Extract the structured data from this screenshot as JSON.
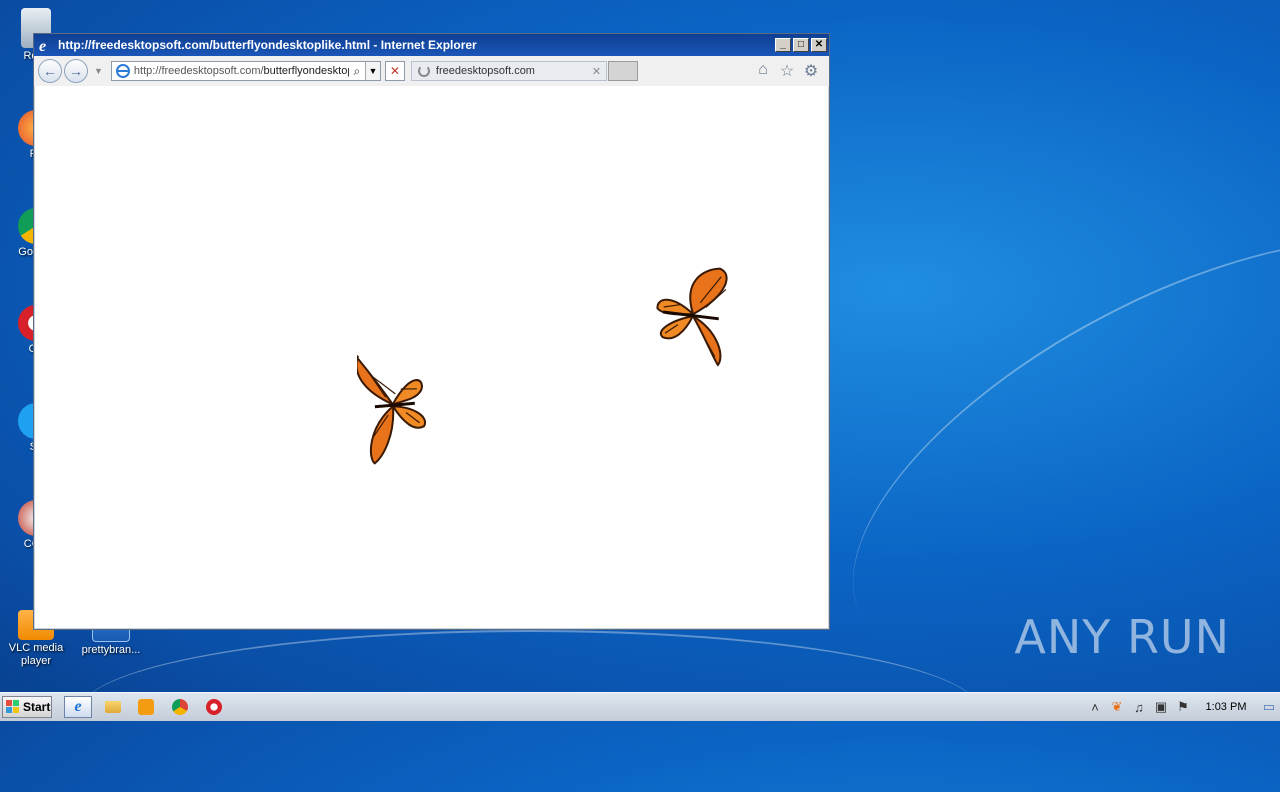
{
  "desktop": {
    "icons": [
      {
        "label": "Recy",
        "icon": "recycle-bin-icon"
      },
      {
        "label": "Fir",
        "icon": "firefox-icon"
      },
      {
        "label": "Go Chr",
        "icon": "chrome-icon"
      },
      {
        "label": "Op",
        "icon": "opera-icon"
      },
      {
        "label": "Sk",
        "icon": "skype-icon"
      },
      {
        "label": "CCle",
        "icon": "ccleaner-icon"
      },
      {
        "label": "VLC media player",
        "icon": "vlc-icon"
      },
      {
        "label": "prettybran...",
        "icon": "file-icon"
      }
    ],
    "watermark": "ANY RUN"
  },
  "window": {
    "title": "http://freedesktopsoft.com/butterflyondesktoplike.html - Internet Explorer",
    "address_host": "http://freedesktopsoft.com/",
    "address_path": "butterflyondesktop",
    "tab_label": "freedesktopsoft.com",
    "controls": {
      "minimize": "_",
      "maximize": "□",
      "close": "✕"
    }
  },
  "content": {
    "butterflies": [
      "butterfly-icon",
      "butterfly-icon"
    ]
  },
  "taskbar": {
    "start_label": "Start",
    "apps": [
      "ie-icon",
      "explorer-icon",
      "media-player-icon",
      "chrome-icon",
      "opera-icon"
    ],
    "clock": "1:03 PM"
  },
  "colors": {
    "titlebar": "#1a56b8",
    "desktop": "#0b64c4",
    "butterfly": "#e8731a"
  }
}
